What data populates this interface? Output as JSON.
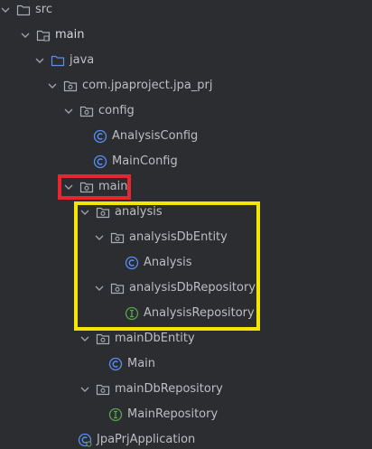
{
  "colors": {
    "background": "#2b2d30",
    "text": "#bcbec4",
    "folder_icon": "#a7adb5",
    "class_icon": "#5b8ef0",
    "interface_icon": "#58a34c",
    "highlight_red": "#e8262e",
    "highlight_yellow": "#f6e500"
  },
  "tree": [
    {
      "label": "src",
      "icon": "folder-icon",
      "expanded": true
    },
    {
      "label": "main",
      "icon": "source-root-folder-icon",
      "expanded": true
    },
    {
      "label": "java",
      "icon": "source-folder-icon",
      "expanded": true
    },
    {
      "label": "com.jpaproject.jpa_prj",
      "icon": "package-icon",
      "expanded": true
    },
    {
      "label": "config",
      "icon": "package-icon",
      "expanded": true
    },
    {
      "label": "AnalysisConfig",
      "icon": "class-icon"
    },
    {
      "label": "MainConfig",
      "icon": "class-icon"
    },
    {
      "label": "main",
      "icon": "package-icon",
      "expanded": true,
      "highlighted": "red"
    },
    {
      "label": "analysis",
      "icon": "package-icon",
      "expanded": true,
      "highlighted": "yellow"
    },
    {
      "label": "analysisDbEntity",
      "icon": "package-icon",
      "expanded": true
    },
    {
      "label": "Analysis",
      "icon": "class-icon"
    },
    {
      "label": "analysisDbRepository",
      "icon": "package-icon",
      "expanded": true
    },
    {
      "label": "AnalysisRepository",
      "icon": "interface-icon"
    },
    {
      "label": "mainDbEntity",
      "icon": "package-icon",
      "expanded": true
    },
    {
      "label": "Main",
      "icon": "class-icon"
    },
    {
      "label": "mainDbRepository",
      "icon": "package-icon",
      "expanded": true
    },
    {
      "label": "MainRepository",
      "icon": "interface-icon"
    },
    {
      "label": "JpaPrjApplication",
      "icon": "spring-class-icon"
    }
  ]
}
